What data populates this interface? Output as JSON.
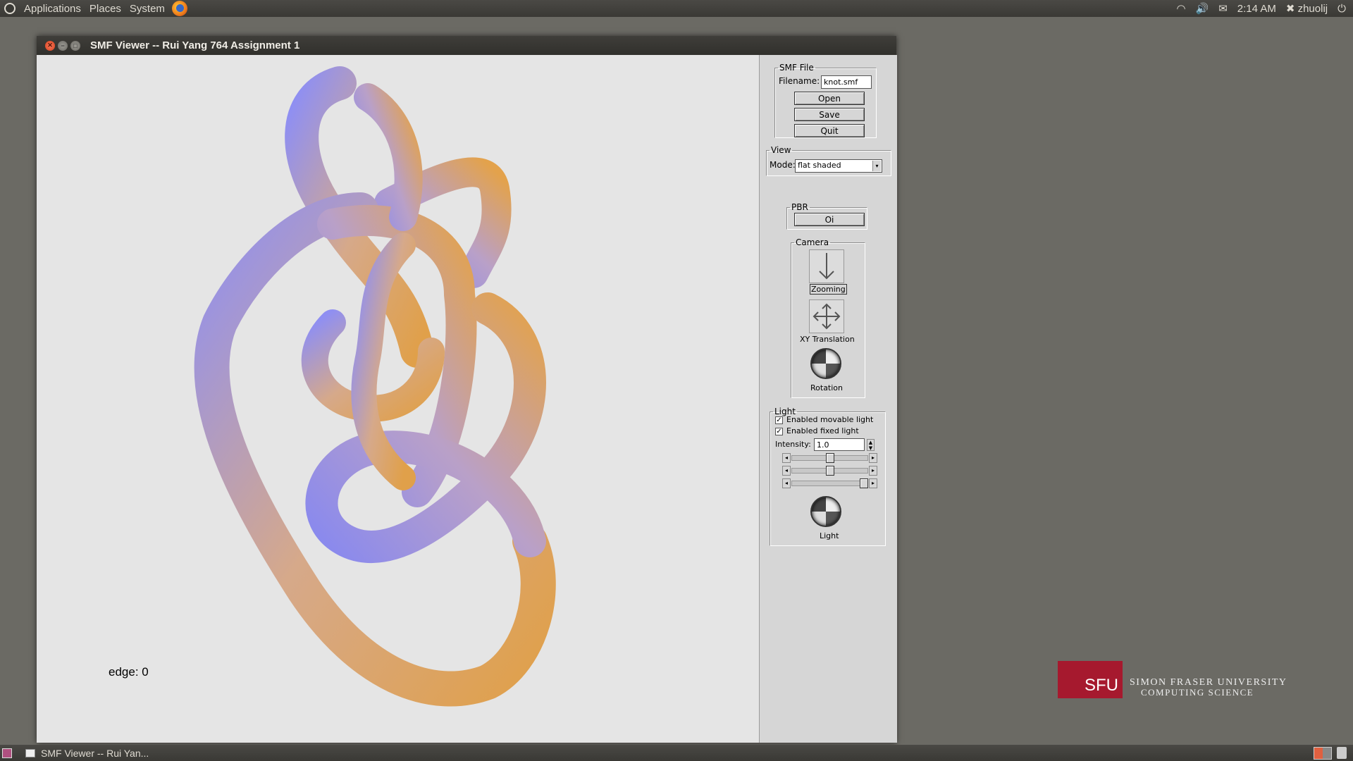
{
  "top_panel": {
    "menus": [
      "Applications",
      "Places",
      "System"
    ],
    "clock": "2:14 AM",
    "user": "zhuolij"
  },
  "window": {
    "title": "SMF Viewer -- Rui Yang 764 Assignment 1",
    "viewport": {
      "edge_label": "edge: 0"
    }
  },
  "side_panel": {
    "smf_file": {
      "legend": "SMF File",
      "filename_label": "Filename:",
      "filename_value": "knot.smf",
      "open": "Open",
      "save": "Save",
      "quit": "Quit"
    },
    "view": {
      "legend": "View",
      "mode_label": "Mode:",
      "mode_value": "flat shaded"
    },
    "pbr": {
      "legend": "PBR",
      "button": "Oi"
    },
    "camera": {
      "legend": "Camera",
      "zooming": "Zooming",
      "xy_translation": "XY Translation",
      "rotation": "Rotation"
    },
    "light": {
      "legend": "Light",
      "movable_label": "Enabled movable light",
      "movable_checked": true,
      "fixed_label": "Enabled fixed light",
      "fixed_checked": true,
      "intensity_label": "Intensity:",
      "intensity_value": "1.0",
      "sliders": [
        0.5,
        0.5,
        1.0
      ],
      "light_label": "Light"
    }
  },
  "taskbar": {
    "item": "SMF Viewer -- Rui Yan..."
  },
  "desktop": {
    "logo_text": "SFU",
    "university": "SIMON FRASER UNIVERSITY",
    "department": "COMPUTING SCIENCE"
  }
}
